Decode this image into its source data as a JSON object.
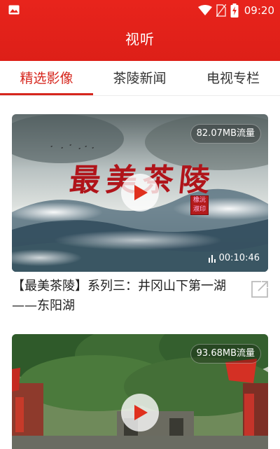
{
  "status_bar": {
    "time": "09:20",
    "icons": [
      "image-notification-icon",
      "wifi-icon",
      "no-sim-icon",
      "battery-charging-icon"
    ]
  },
  "header": {
    "title": "视听"
  },
  "tabs": [
    {
      "label": "精选影像",
      "active": true
    },
    {
      "label": "茶陵新闻",
      "active": false
    },
    {
      "label": "电视专栏",
      "active": false
    }
  ],
  "videos": [
    {
      "thumbnail_text": "最美茶陵",
      "seal_text": "橡沅 淑印",
      "size": "82.07MB流量",
      "duration": "00:10:46",
      "title": "【最美茶陵】系列三：井冈山下第一湖——东阳湖"
    },
    {
      "size": "93.68MB流量"
    }
  ],
  "colors": {
    "accent": "#d6261d",
    "header": "#e8241c"
  }
}
